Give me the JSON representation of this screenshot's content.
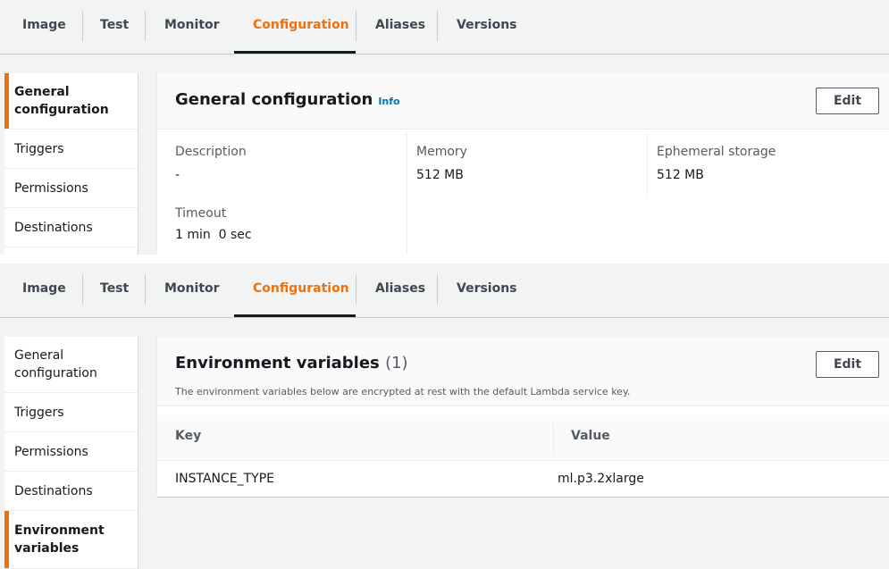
{
  "tabs": [
    {
      "label": "Image"
    },
    {
      "label": "Test"
    },
    {
      "label": "Monitor"
    },
    {
      "label": "Configuration",
      "active": true
    },
    {
      "label": "Aliases"
    },
    {
      "label": "Versions"
    }
  ],
  "top_panel": {
    "sidenav": [
      {
        "label": "General\nconfiguration",
        "active": true
      },
      {
        "label": "Triggers"
      },
      {
        "label": "Permissions"
      },
      {
        "label": "Destinations"
      }
    ],
    "card": {
      "title": "General configuration",
      "info_link": "Info",
      "edit_label": "Edit",
      "fields": {
        "description_label": "Description",
        "description_value": "-",
        "timeout_label": "Timeout",
        "timeout_value": "1 min  0 sec",
        "memory_label": "Memory",
        "memory_value": "512 MB",
        "ephemeral_label": "Ephemeral storage",
        "ephemeral_value": "512 MB"
      }
    }
  },
  "bottom_panel": {
    "sidenav": [
      {
        "label": "General\nconfiguration"
      },
      {
        "label": "Triggers"
      },
      {
        "label": "Permissions"
      },
      {
        "label": "Destinations"
      },
      {
        "label": "Environment\nvariables",
        "active": true
      }
    ],
    "card": {
      "title": "Environment variables",
      "count": "(1)",
      "subtitle": "The environment variables below are encrypted at rest with the default Lambda service key.",
      "edit_label": "Edit",
      "columns": [
        "Key",
        "Value"
      ],
      "rows": [
        {
          "key": "INSTANCE_TYPE",
          "value": "ml.p3.2xlarge"
        }
      ]
    }
  },
  "colors": {
    "accent": "#ec7211",
    "link": "#0073bb",
    "panel_bg": "#f2f3f3"
  }
}
